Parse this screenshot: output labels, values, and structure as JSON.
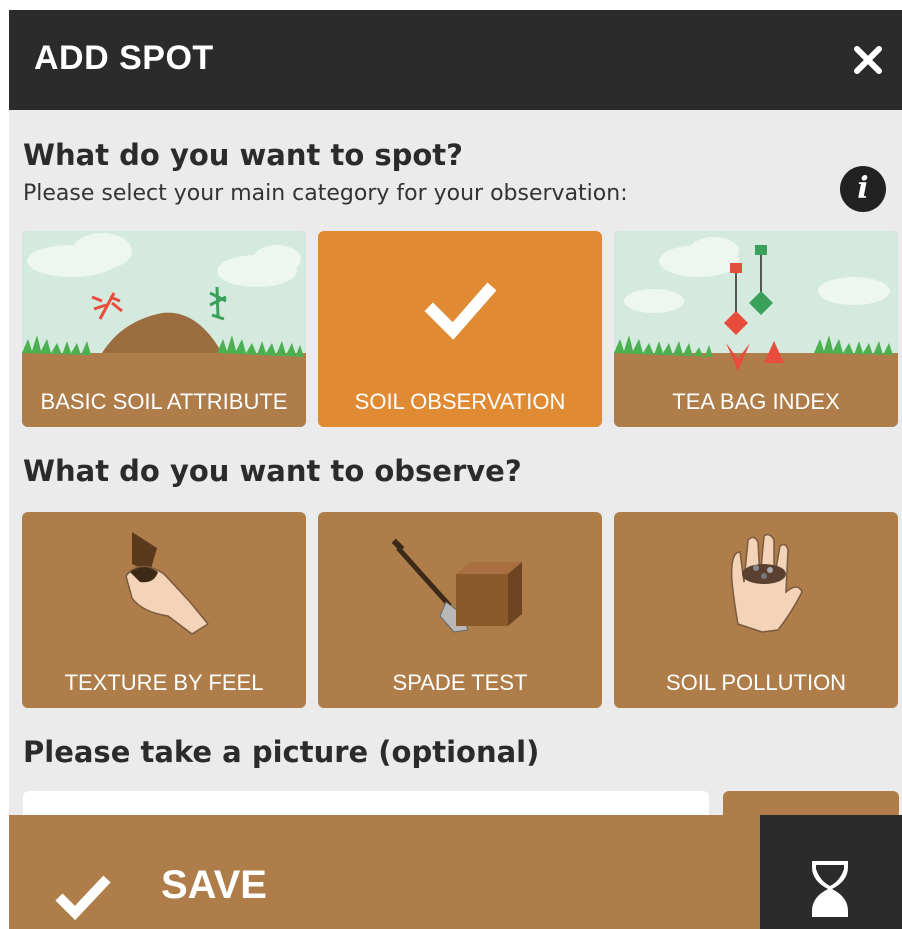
{
  "header": {
    "title": "ADD SPOT",
    "close_icon": "close-icon"
  },
  "category_section": {
    "heading": "What do you want to spot?",
    "subheading": "Please select your main category for your observation:",
    "info_icon": "info-icon",
    "cards": [
      {
        "label": "BASIC SOIL ATTRIBUTE",
        "selected": false
      },
      {
        "label": "SOIL OBSERVATION",
        "selected": true
      },
      {
        "label": "TEA BAG INDEX",
        "selected": false
      }
    ]
  },
  "observe_section": {
    "heading": "What do you want to observe?",
    "cards": [
      {
        "label": "TEXTURE BY FEEL"
      },
      {
        "label": "SPADE TEST"
      },
      {
        "label": "SOIL POLLUTION"
      }
    ]
  },
  "picture_section": {
    "heading": "Please take a picture (optional)"
  },
  "footer": {
    "save_label": "SAVE",
    "save_icon": "checkmark-icon",
    "draft_icon": "hourglass-icon"
  },
  "colors": {
    "header": "#2b2b2b",
    "card": "#ae7d4a",
    "selected": "#e08b33",
    "background": "#ebebeb",
    "sky": "#d4eade"
  }
}
